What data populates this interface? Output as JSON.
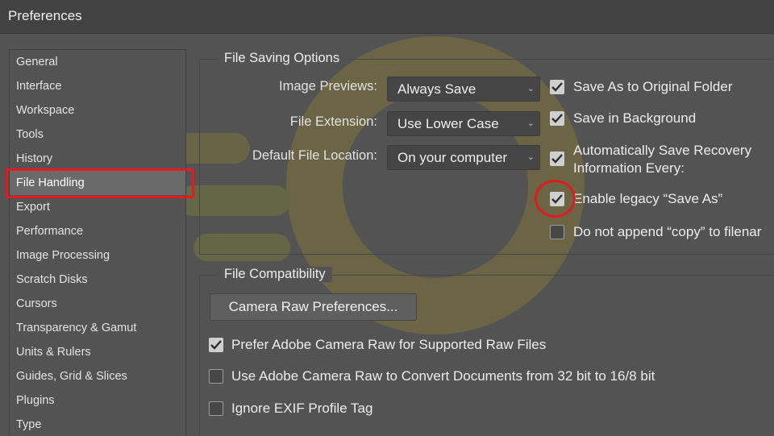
{
  "window": {
    "title": "Preferences"
  },
  "sidebar": {
    "selected_index": 5,
    "items": [
      {
        "label": "General"
      },
      {
        "label": "Interface"
      },
      {
        "label": "Workspace"
      },
      {
        "label": "Tools"
      },
      {
        "label": "History"
      },
      {
        "label": "File Handling"
      },
      {
        "label": "Export"
      },
      {
        "label": "Performance"
      },
      {
        "label": "Image Processing"
      },
      {
        "label": "Scratch Disks"
      },
      {
        "label": "Cursors"
      },
      {
        "label": "Transparency & Gamut"
      },
      {
        "label": "Units & Rulers"
      },
      {
        "label": "Guides, Grid & Slices"
      },
      {
        "label": "Plugins"
      },
      {
        "label": "Type"
      }
    ]
  },
  "file_saving": {
    "group_label": "File Saving Options",
    "image_previews": {
      "label": "Image Previews:",
      "value": "Always Save"
    },
    "file_extension": {
      "label": "File Extension:",
      "value": "Use Lower Case"
    },
    "default_location": {
      "label": "Default File Location:",
      "value": "On your computer"
    },
    "options": [
      {
        "label": "Save As to Original Folder",
        "checked": true
      },
      {
        "label": "Save in Background",
        "checked": true
      },
      {
        "label_line1": "Automatically Save Recovery",
        "label_line2": "Information Every:",
        "checked": true
      },
      {
        "label": "Enable legacy “Save As”",
        "checked": true
      },
      {
        "label": "Do not append “copy” to filenar",
        "checked": false
      }
    ]
  },
  "file_compat": {
    "group_label": "File Compatibility",
    "camera_raw_button": "Camera Raw Preferences...",
    "options": [
      {
        "label": "Prefer Adobe Camera Raw for Supported Raw Files",
        "checked": true
      },
      {
        "label": "Use Adobe Camera Raw to Convert Documents from 32 bit to 16/8 bit",
        "checked": false
      },
      {
        "label": "Ignore EXIF Profile Tag",
        "checked": false
      }
    ]
  },
  "colors": {
    "background": "#535353",
    "titlebar": "#424242",
    "annotation_red": "#e8181e",
    "checkbox_checked": "#cfcfcf"
  }
}
